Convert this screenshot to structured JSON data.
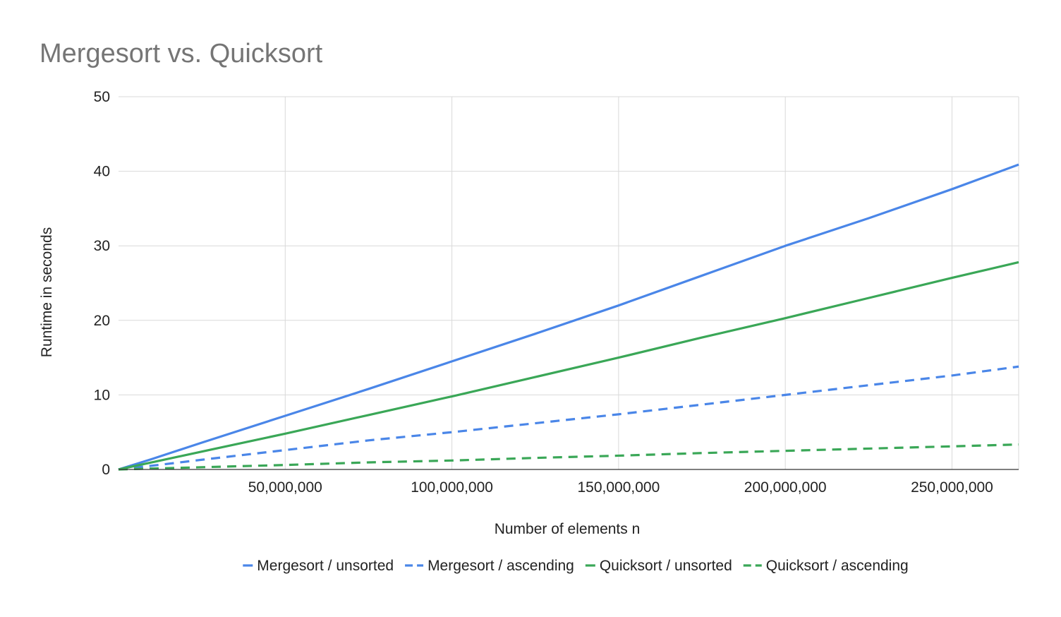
{
  "chart_data": {
    "type": "line",
    "title": "Mergesort vs. Quicksort",
    "xlabel": "Number of elements n",
    "ylabel": "Runtime in seconds",
    "xlim": [
      0,
      270000000
    ],
    "ylim": [
      0,
      50
    ],
    "x_ticks": [
      50000000,
      100000000,
      150000000,
      200000000,
      250000000
    ],
    "x_tick_labels": [
      "50,000,000",
      "100,000,000",
      "150,000,000",
      "200,000,000",
      "250,000,000"
    ],
    "y_ticks": [
      0,
      10,
      20,
      30,
      40,
      50
    ],
    "y_tick_labels": [
      "0",
      "10",
      "20",
      "30",
      "40",
      "50"
    ],
    "grid": true,
    "legend_position": "bottom",
    "series": [
      {
        "name": "Mergesort / unsorted",
        "color": "#4a86e8",
        "dashed": false,
        "x": [
          0,
          10000000,
          25000000,
          50000000,
          75000000,
          100000000,
          125000000,
          150000000,
          175000000,
          200000000,
          225000000,
          250000000,
          270000000
        ],
        "y": [
          0,
          1.4,
          3.6,
          7.2,
          10.8,
          14.5,
          18.2,
          22.0,
          26.0,
          30.0,
          33.7,
          37.6,
          40.9
        ]
      },
      {
        "name": "Mergesort / ascending",
        "color": "#4a86e8",
        "dashed": true,
        "x": [
          0,
          10000000,
          25000000,
          50000000,
          75000000,
          100000000,
          125000000,
          150000000,
          175000000,
          200000000,
          225000000,
          250000000,
          270000000
        ],
        "y": [
          0,
          0.5,
          1.3,
          2.6,
          3.9,
          5.0,
          6.2,
          7.4,
          8.7,
          10.0,
          11.3,
          12.6,
          13.8
        ]
      },
      {
        "name": "Quicksort / unsorted",
        "color": "#3aa757",
        "dashed": false,
        "x": [
          0,
          10000000,
          25000000,
          50000000,
          75000000,
          100000000,
          125000000,
          150000000,
          175000000,
          200000000,
          225000000,
          250000000,
          270000000
        ],
        "y": [
          0,
          0.95,
          2.4,
          4.8,
          7.3,
          9.8,
          12.4,
          15.0,
          17.7,
          20.3,
          23.0,
          25.7,
          27.8
        ]
      },
      {
        "name": "Quicksort / ascending",
        "color": "#3aa757",
        "dashed": true,
        "x": [
          0,
          10000000,
          25000000,
          50000000,
          75000000,
          100000000,
          125000000,
          150000000,
          175000000,
          200000000,
          225000000,
          250000000,
          270000000
        ],
        "y": [
          0,
          0.12,
          0.3,
          0.6,
          0.95,
          1.2,
          1.55,
          1.85,
          2.2,
          2.5,
          2.8,
          3.1,
          3.35
        ]
      }
    ]
  }
}
